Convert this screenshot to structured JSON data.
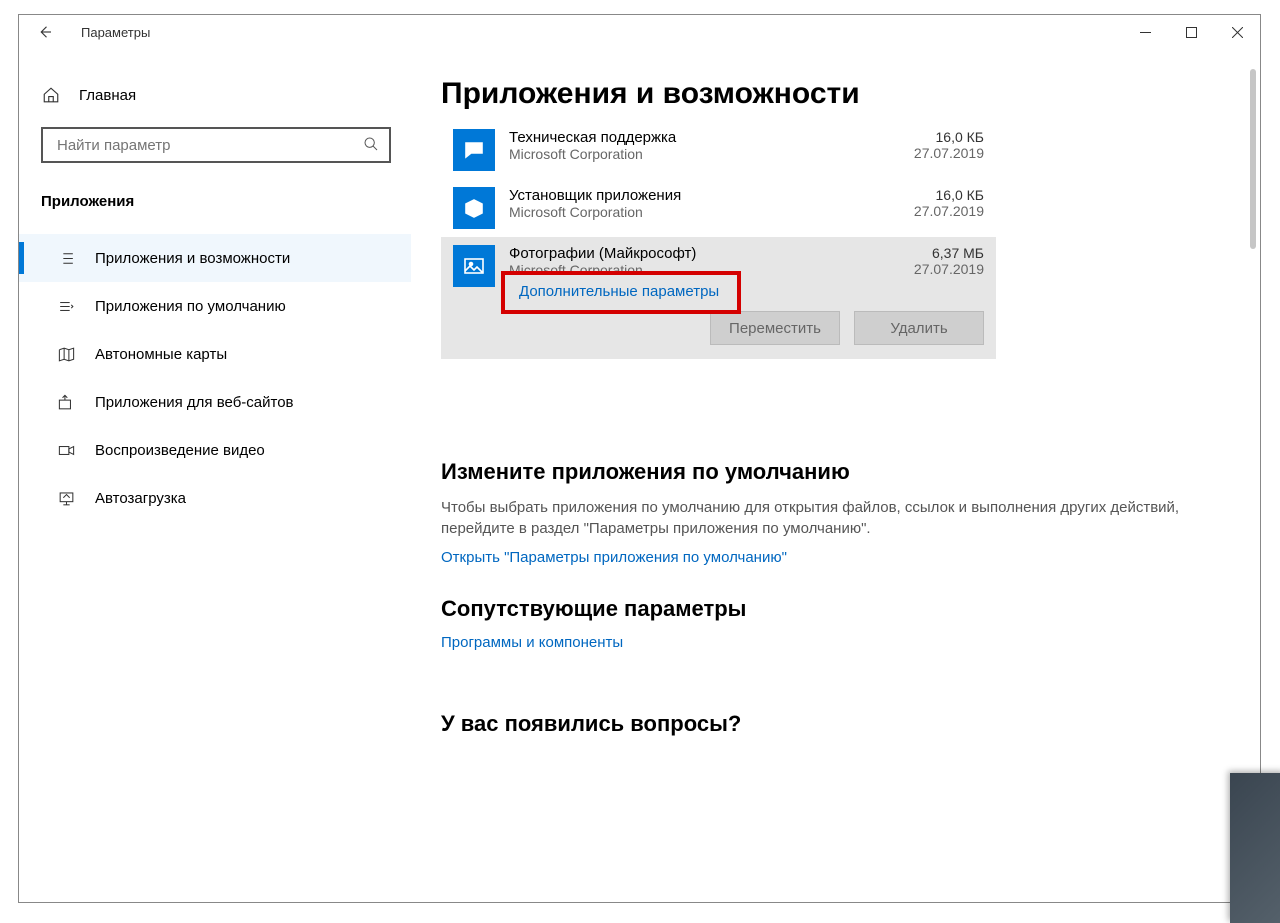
{
  "window": {
    "title": "Параметры"
  },
  "sidebar": {
    "home": "Главная",
    "search_placeholder": "Найти параметр",
    "section": "Приложения",
    "items": [
      {
        "label": "Приложения и возможности"
      },
      {
        "label": "Приложения по умолчанию"
      },
      {
        "label": "Автономные карты"
      },
      {
        "label": "Приложения для веб-сайтов"
      },
      {
        "label": "Воспроизведение видео"
      },
      {
        "label": "Автозагрузка"
      }
    ]
  },
  "main": {
    "heading": "Приложения и возможности",
    "apps": [
      {
        "name": "Техническая поддержка",
        "publisher": "Microsoft Corporation",
        "size": "16,0 КБ",
        "date": "27.07.2019"
      },
      {
        "name": "Установщик приложения",
        "publisher": "Microsoft Corporation",
        "size": "16,0 КБ",
        "date": "27.07.2019"
      },
      {
        "name": "Фотографии (Майкрософт)",
        "publisher": "Microsoft Corporation",
        "size": "6,37 МБ",
        "date": "27.07.2019"
      }
    ],
    "advanced_link": "Дополнительные параметры",
    "move_btn": "Переместить",
    "delete_btn": "Удалить",
    "default_heading": "Измените приложения по умолчанию",
    "default_para": "Чтобы выбрать приложения по умолчанию для открытия файлов, ссылок и выполнения других действий, перейдите в раздел \"Параметры приложения по умолчанию\".",
    "default_link": "Открыть \"Параметры приложения по умолчанию\"",
    "related_heading": "Сопутствующие параметры",
    "related_link": "Программы и компоненты",
    "questions_heading": "У вас появились вопросы?"
  }
}
